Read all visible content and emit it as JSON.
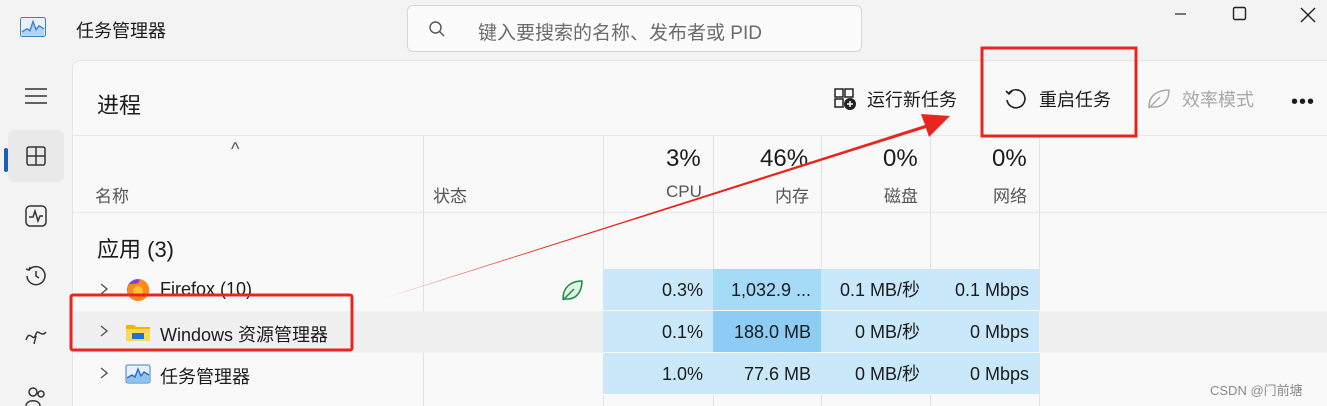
{
  "window": {
    "title": "任务管理器",
    "search_placeholder": "键入要搜索的名称、发布者或 PID"
  },
  "toolbar": {
    "page_title": "进程",
    "run_new_task": "运行新任务",
    "restart_task": "重启任务",
    "efficiency_mode": "效率模式",
    "more": "•••"
  },
  "columns": {
    "name": "名称",
    "status": "状态",
    "cpu_pct": "3%",
    "cpu": "CPU",
    "mem_pct": "46%",
    "mem": "内存",
    "disk_pct": "0%",
    "disk": "磁盘",
    "net_pct": "0%",
    "net": "网络"
  },
  "group": {
    "title": "应用 (3)"
  },
  "rows": [
    {
      "name": "Firefox (10)",
      "icon": "firefox-icon",
      "efficiency_leaf": true,
      "cpu": "0.3%",
      "mem": "1,032.9 ...",
      "disk": "0.1 MB/秒",
      "net": "0.1 Mbps"
    },
    {
      "name": "Windows 资源管理器",
      "icon": "folder-icon",
      "efficiency_leaf": false,
      "cpu": "0.1%",
      "mem": "188.0 MB",
      "disk": "0 MB/秒",
      "net": "0 Mbps"
    },
    {
      "name": "任务管理器",
      "icon": "task-manager-icon",
      "efficiency_leaf": false,
      "cpu": "1.0%",
      "mem": "77.6 MB",
      "disk": "0 MB/秒",
      "net": "0 Mbps"
    }
  ],
  "watermark": "CSDN @门前塘",
  "colors": {
    "heat_light": "#c9e9fb",
    "heat_medium": "#a6dbf8",
    "heat_strong": "#8dcdf5",
    "annotation_red": "#e8261e",
    "accent": "#1a5fb4"
  }
}
